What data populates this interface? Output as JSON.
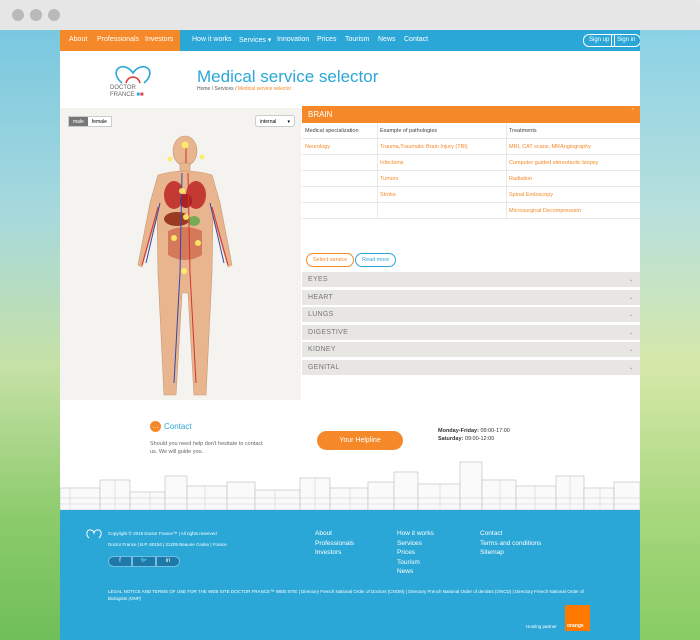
{
  "nav": {
    "orange_items": [
      "About",
      "Professionals",
      "Investors"
    ],
    "items": [
      "How it works",
      "Services ▾",
      "Innovation",
      "Prices",
      "Tourism",
      "News",
      "Contact"
    ],
    "signup": "Sign up",
    "signin": "Sign in",
    "lang": "EN"
  },
  "header": {
    "logo_line1": "DOCTOR",
    "logo_line2": "FRANCE",
    "title": "Medical service selector",
    "crumb_prefix": "Home / Services / ",
    "crumb_current": "Medical service selector"
  },
  "body_panel": {
    "toggle_male": "male",
    "toggle_female": "female",
    "view_select": "internal"
  },
  "brain": {
    "title": "BRAIN",
    "headers": [
      "Medical specialization",
      "Example of pathologies",
      "Treatments"
    ],
    "rows": [
      [
        "Neurology",
        "Trauma,Traumatic Brain Injury (TBI)",
        "MRI, CAT scans, MRAngiography"
      ],
      [
        "",
        "Infections",
        "Computer guided stereotactic biopsy"
      ],
      [
        "",
        "Tumors",
        "Radiation"
      ],
      [
        "",
        "Stroke",
        "Spinal Endoscopy"
      ],
      [
        "",
        "",
        "Microsurgical Decompression"
      ]
    ],
    "select_label": "Select service",
    "more_label": "Read more"
  },
  "accordion": [
    "EYES",
    "HEART",
    "LUNGS",
    "DIGESTIVE",
    "KIDNEY",
    "GENITAL"
  ],
  "contact": {
    "title": "Contact",
    "text": "Should you need help don't hesitate to contact us. We will guide you.",
    "helpline": "Your Helpline",
    "hours1_label": "Monday-Friday:",
    "hours1": " 09:00-17:00",
    "hours2_label": "Saturday:",
    "hours2": " 09:00-12:00"
  },
  "footer": {
    "copyright": "Copyright © 2015 Doctor France™ | All rights reserved",
    "address": "Doctor France | B.P. 60194 | 21205 Beaune Cedex | France",
    "col1": [
      "About",
      "Professionals",
      "Investors"
    ],
    "col2": [
      "How it works",
      "Services",
      "Prices",
      "Tourism",
      "News"
    ],
    "col3": [
      "Contact",
      "Terms and conditions",
      "Sitemap"
    ],
    "social": [
      "f",
      "🐦",
      "in"
    ],
    "legal": "LEGAL NOTICE AND TERMS OF USE FOR THE WEB SITE DOCTOR FRANCE™ WEB SITE | Directory French National Order of Doctors (CNOM) | Directory French National Order of dentists (ONCD) | Directory French National Order of Biologists (ONP)",
    "hosting": "Hosting partner",
    "partner_logo_text": "orange"
  },
  "colors": {
    "accent": "#f5892a",
    "brand": "#2aa7d6",
    "footer": "#2aa7d6"
  }
}
